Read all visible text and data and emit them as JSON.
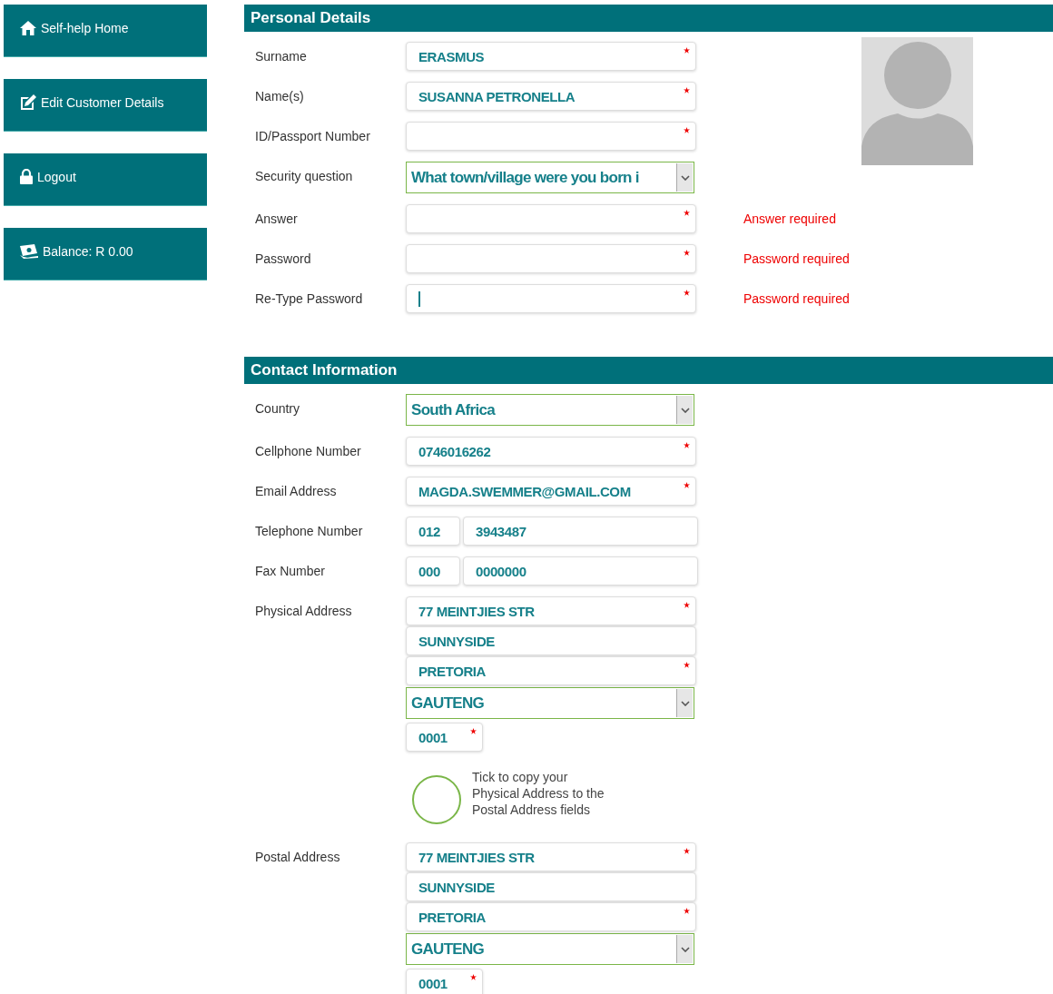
{
  "sidebar": {
    "items": [
      {
        "label": "Self-help Home"
      },
      {
        "label": "Edit Customer Details"
      },
      {
        "label": "Logout"
      },
      {
        "label": "Balance: R 0.00"
      }
    ]
  },
  "sections": [
    {
      "title": "Personal Details",
      "has_photo": true,
      "rows": [
        {
          "label": "Surname",
          "kind": "text",
          "fields": [
            {
              "kind": "text",
              "value": "ERASMUS",
              "required": true,
              "focused": false
            }
          ]
        },
        {
          "label": "Name(s)",
          "kind": "text",
          "fields": [
            {
              "kind": "text",
              "value": "SUSANNA PETRONELLA",
              "required": true,
              "focused": false
            }
          ]
        },
        {
          "label": "ID/Passport Number",
          "kind": "text",
          "fields": [
            {
              "kind": "text",
              "required": true,
              "focused": false
            }
          ]
        },
        {
          "label": "Security question",
          "kind": "text",
          "fields": [
            {
              "kind": "select",
              "value": "What town/village were you born i"
            }
          ]
        },
        {
          "label": "Answer",
          "kind": "text",
          "error": "Answer required",
          "fields": [
            {
              "kind": "text",
              "required": true,
              "focused": false
            }
          ]
        },
        {
          "label": "Password",
          "kind": "text",
          "error": "Password required",
          "fields": [
            {
              "kind": "text",
              "required": true,
              "focused": false
            }
          ]
        },
        {
          "label": "Re-Type Password",
          "kind": "text",
          "error": "Password required",
          "fields": [
            {
              "kind": "text",
              "required": true,
              "focused": true
            }
          ]
        }
      ]
    },
    {
      "title": "Contact Information",
      "rows": [
        {
          "label": "Country",
          "kind": "text",
          "fields": [
            {
              "kind": "select",
              "value": "South Africa"
            }
          ]
        },
        {
          "label": "Cellphone Number",
          "kind": "text",
          "fields": [
            {
              "kind": "text",
              "value": "0746016262",
              "required": true,
              "focused": false
            }
          ]
        },
        {
          "label": "Email Address",
          "kind": "text",
          "fields": [
            {
              "kind": "text",
              "value": "MAGDA.SWEMMER@GMAIL.COM",
              "required": true,
              "focused": false
            }
          ]
        },
        {
          "label": "Telephone Number",
          "kind": "split",
          "fields": [
            {
              "kind": "short",
              "value": "012",
              "required": false,
              "focused": false
            },
            {
              "kind": "text",
              "value": "3943487",
              "required": false,
              "focused": false
            }
          ]
        },
        {
          "label": "Fax Number",
          "kind": "split",
          "fields": [
            {
              "kind": "short",
              "value": "000",
              "required": false,
              "focused": false
            },
            {
              "kind": "text",
              "value": "0000000",
              "required": false,
              "focused": false
            }
          ]
        },
        {
          "label": "Physical Address",
          "kind": "stack",
          "fields": [
            {
              "kind": "text",
              "value": "77 MEINTJIES STR",
              "required": true,
              "focused": false
            },
            {
              "kind": "text",
              "value": "SUNNYSIDE",
              "required": false,
              "focused": false
            },
            {
              "kind": "text",
              "value": "PRETORIA",
              "required": true,
              "focused": false
            },
            {
              "kind": "select",
              "value": "GAUTENG"
            },
            {
              "kind": "short",
              "value": "0001",
              "required": true,
              "focused": false
            }
          ]
        },
        {
          "kind": "tick",
          "checked": false,
          "text": "Tick to copy your Physical Address to the Postal Address fields"
        },
        {
          "label": "Postal Address",
          "kind": "stack",
          "fields": [
            {
              "kind": "text",
              "value": "77 MEINTJIES STR",
              "required": true,
              "focused": false
            },
            {
              "kind": "text",
              "value": "SUNNYSIDE",
              "required": false,
              "focused": false
            },
            {
              "kind": "text",
              "value": "PRETORIA",
              "required": true,
              "focused": false
            },
            {
              "kind": "select",
              "value": "GAUTENG"
            },
            {
              "kind": "short",
              "value": "0001",
              "required": true,
              "focused": false
            }
          ]
        }
      ]
    }
  ]
}
